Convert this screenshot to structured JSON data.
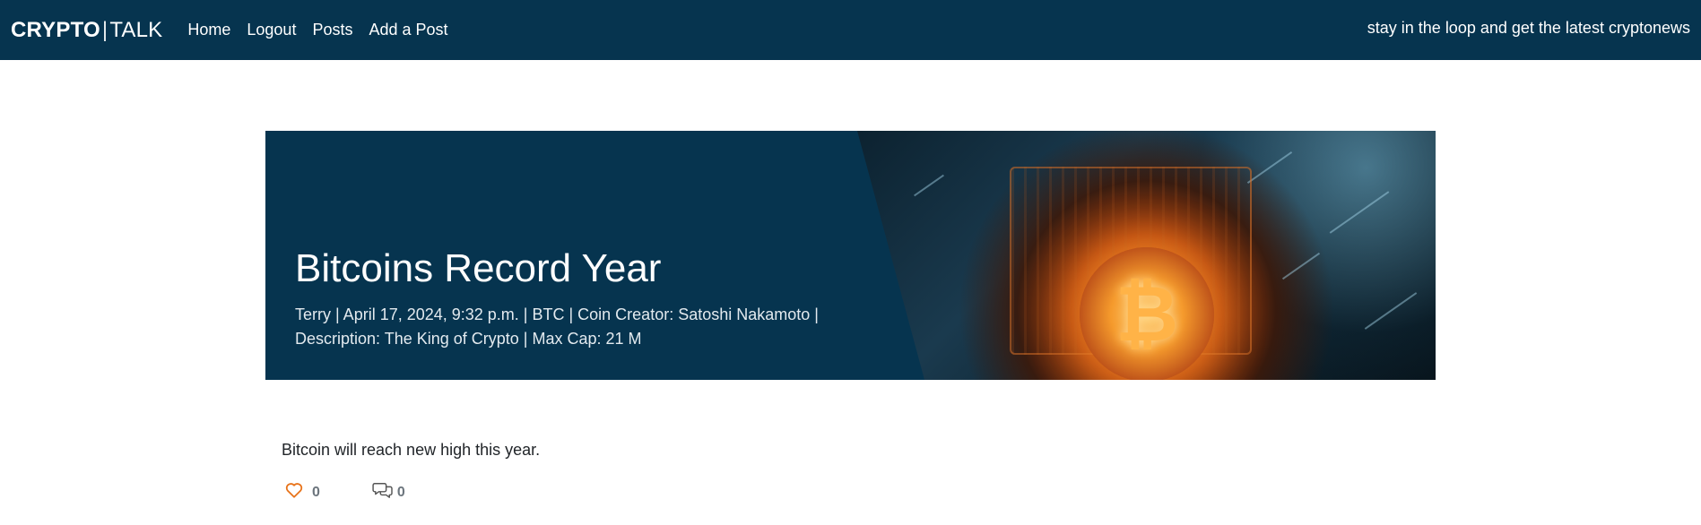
{
  "navbar": {
    "brand_strong": "CRYPTO",
    "brand_sep": "|",
    "brand_light": "TALK",
    "links": [
      "Home",
      "Logout",
      "Posts",
      "Add a Post"
    ],
    "tagline": "stay in the loop and get the latest cryptonews"
  },
  "post": {
    "title": "Bitcoins Record Year",
    "meta_line1": "Terry | April 17, 2024, 9:32 p.m. | BTC | Coin Creator: Satoshi Nakamoto |",
    "meta_line2": "Description: The King of Crypto | Max Cap: 21 M",
    "body": "Bitcoin will reach new high this year.",
    "likes": "0",
    "comments": "0"
  },
  "icons": {
    "like": "heart-icon",
    "comment": "comments-icon"
  },
  "colors": {
    "navbar_bg": "#06344f",
    "hero_bg": "#06344f",
    "heart": "#e8731a",
    "muted": "#6c757d"
  }
}
